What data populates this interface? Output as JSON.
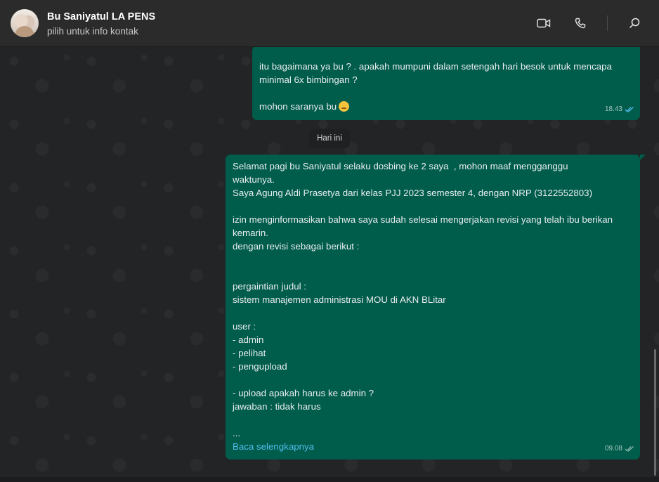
{
  "header": {
    "contact_name": "Bu Saniyatul LA PENS",
    "subtitle": "pilih untuk info kontak",
    "icons": [
      "video-call-icon",
      "voice-call-icon",
      "search-icon"
    ]
  },
  "date_separator": "Hari ini",
  "messages": [
    {
      "lines": [
        "itu bagaimana ya bu ? . apakah mumpuni dalam setengah hari besok untuk mencapa",
        "minimal 6x bimbingan ?",
        "",
        "mohon saranya bu"
      ],
      "emoji": "woozy-face",
      "time": "18.43"
    },
    {
      "lines": [
        "Selamat pagi bu Saniyatul selaku dosbing ke 2 saya  , mohon maaf mengganggu",
        "waktunya.",
        "Saya Agung Aldi Prasetya dari kelas PJJ 2023 semester 4, dengan NRP (3122552803)",
        "",
        "izin menginformasikan bahwa saya sudah selesai mengerjakan revisi yang telah ibu berikan",
        "kemarin.",
        "dengan revisi sebagai berikut :",
        "",
        "",
        "pergaintian judul :",
        "sistem manajemen administrasi MOU di AKN BLitar",
        "",
        "user :",
        "- admin",
        "- pelihat",
        "- pengupload",
        "",
        "- upload apakah harus ke admin ?",
        "jawaban : tidak harus",
        "",
        "..."
      ],
      "read_more": "Baca selengkapnya",
      "time": "09.08"
    }
  ],
  "colors": {
    "outgoing_bubble": "#005c4b",
    "read_tick": "#53bdeb",
    "header_bg": "#2b2b2b"
  }
}
